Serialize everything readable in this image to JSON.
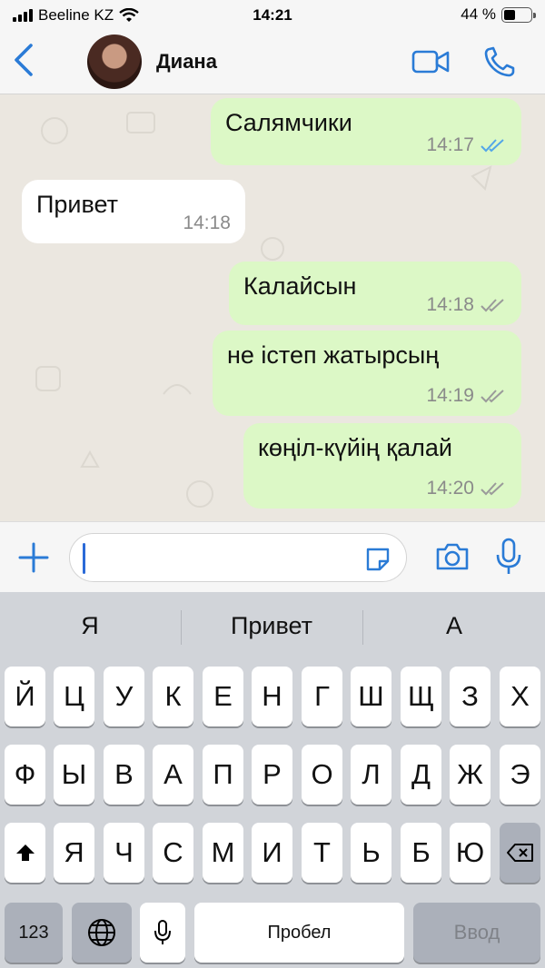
{
  "status_bar": {
    "carrier": "Beeline KZ",
    "time": "14:21",
    "battery": "44 %"
  },
  "header": {
    "contact_name": "Диана"
  },
  "messages": [
    {
      "direction": "out",
      "text": "Салямчики",
      "time": "14:17",
      "status": "read"
    },
    {
      "direction": "in",
      "text": "Привет",
      "time": "14:18"
    },
    {
      "direction": "out",
      "text": "Калайсын",
      "time": "14:18",
      "status": "delivered"
    },
    {
      "direction": "out",
      "text": "не істеп жатырсың",
      "time": "14:19",
      "status": "delivered"
    },
    {
      "direction": "out",
      "text": "көңіл-күйің қалай",
      "time": "14:20",
      "status": "delivered"
    }
  ],
  "input": {
    "value": ""
  },
  "keyboard": {
    "suggestions": [
      "Я",
      "Привет",
      "А"
    ],
    "row1": [
      "Й",
      "Ц",
      "У",
      "К",
      "Е",
      "Н",
      "Г",
      "Ш",
      "Щ",
      "З",
      "Х"
    ],
    "row2": [
      "Ф",
      "Ы",
      "В",
      "А",
      "П",
      "Р",
      "О",
      "Л",
      "Д",
      "Ж",
      "Э"
    ],
    "row3": [
      "Я",
      "Ч",
      "С",
      "М",
      "И",
      "Т",
      "Ь",
      "Б",
      "Ю"
    ],
    "numbers_key": "123",
    "space_key": "Пробел",
    "return_key": "Ввод"
  },
  "colors": {
    "accent": "#2a7bd6",
    "outgoing_bubble": "#dcf8c6",
    "incoming_bubble": "#ffffff",
    "read_tick": "#53a6e8"
  }
}
